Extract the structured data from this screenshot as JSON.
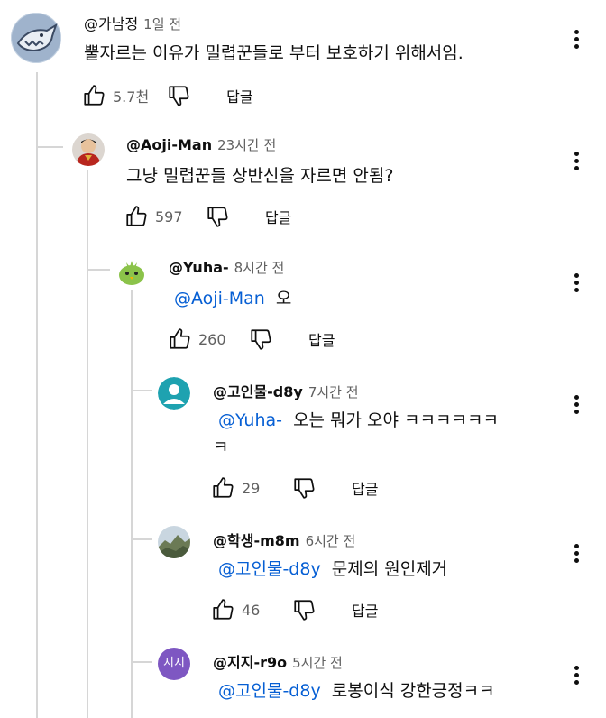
{
  "comments": [
    {
      "author": "@가남정",
      "time": "1일 전",
      "mention": "",
      "text": "뿔자르는 이유가 밀렵꾼들로 부터 보호하기 위해서임.",
      "likes": "5.7천",
      "reply_label": "답글",
      "avatar_icon": "shark-avatar"
    },
    {
      "author": "@Aoji-Man",
      "time": "23시간 전",
      "mention": "",
      "text": "그냥 밀렵꾼들 상반신을 자르면 안됨?",
      "likes": "597",
      "reply_label": "답글",
      "avatar_icon": "ironman-avatar"
    },
    {
      "author": "@Yuha-",
      "time": "8시간 전",
      "mention": "@Aoji-Man",
      "text": "오",
      "likes": "260",
      "reply_label": "답글",
      "avatar_icon": "green-bird-avatar"
    },
    {
      "author": "@고인물-d8y",
      "time": "7시간 전",
      "mention": "@Yuha-",
      "text": "오는 뭐가 오야 ㅋㅋㅋㅋㅋㅋ",
      "text2": "ㅋ",
      "likes": "29",
      "reply_label": "답글",
      "avatar_icon": "default-person-avatar",
      "avatar_color": "#1ea2b0"
    },
    {
      "author": "@학생-m8m",
      "time": "6시간 전",
      "mention": "@고인물-d8y",
      "text": "문제의 원인제거",
      "likes": "46",
      "reply_label": "답글",
      "avatar_icon": "mountain-photo-avatar"
    },
    {
      "author": "@지지-r9o",
      "time": "5시간 전",
      "mention": "@고인물-d8y",
      "text": "로봉이식 강한긍정ㅋㅋ",
      "avatar_icon": "initials-avatar",
      "avatar_initials": "지지",
      "avatar_color": "#7e57c2"
    }
  ]
}
